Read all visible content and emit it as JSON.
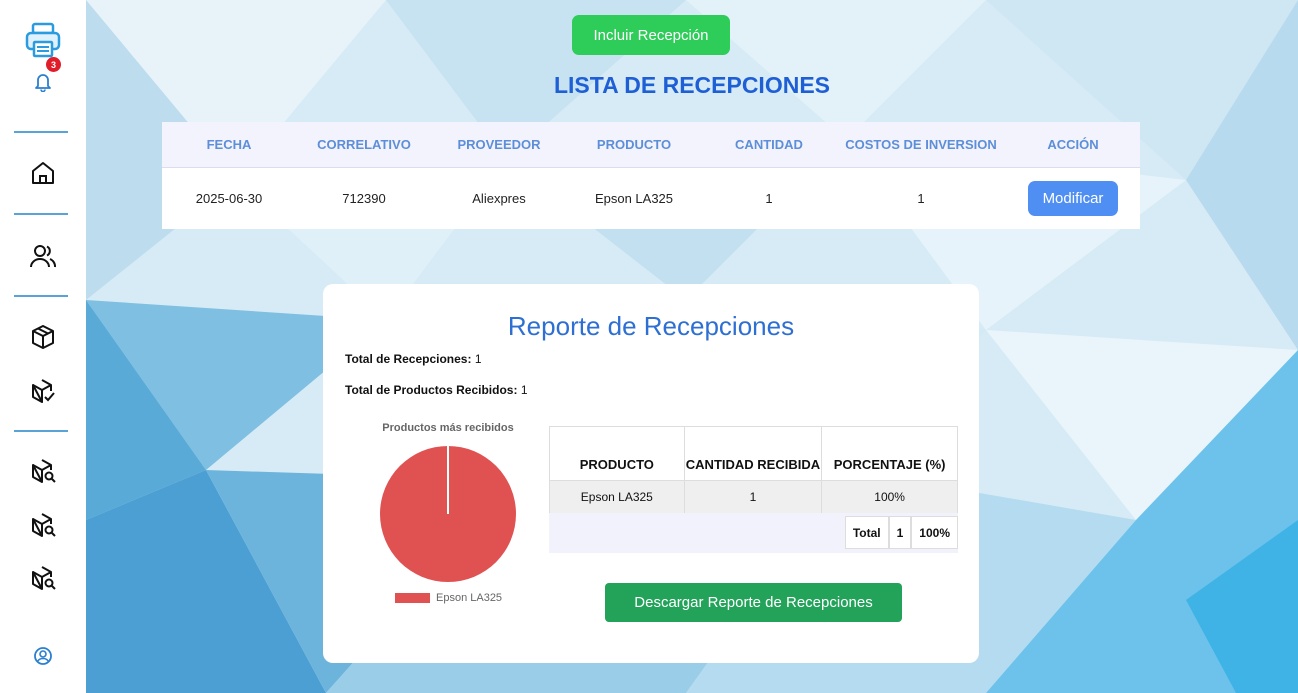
{
  "sidebar": {
    "notification_count": "3",
    "icons": [
      "printer-icon",
      "bell-icon",
      "home-icon",
      "users-icon",
      "box-icon",
      "box-check-icon",
      "box-search-icon",
      "box-search-icon",
      "box-search-icon",
      "user-circle-icon"
    ]
  },
  "header": {
    "include_button": "Incluir Recepción",
    "title": "LISTA DE RECEPCIONES"
  },
  "list_table": {
    "columns": [
      "FECHA",
      "CORRELATIVO",
      "PROVEEDOR",
      "PRODUCTO",
      "CANTIDAD",
      "COSTOS DE INVERSION",
      "ACCIÓN"
    ],
    "rows": [
      {
        "fecha": "2025-06-30",
        "correlativo": "712390",
        "proveedor": "Aliexpres",
        "producto": "Epson LA325",
        "cantidad": "1",
        "costos": "1",
        "accion": "Modificar"
      }
    ]
  },
  "report": {
    "title": "Reporte de Recepciones",
    "total_recepciones_label": "Total de Recepciones:",
    "total_recepciones_value": "1",
    "total_productos_label": "Total de Productos Recibidos:",
    "total_productos_value": "1",
    "chart_title": "Productos más recibidos",
    "table": {
      "columns": [
        "PRODUCTO",
        "CANTIDAD RECIBIDA",
        "PORCENTAJE (%)"
      ],
      "rows": [
        {
          "producto": "Epson LA325",
          "cantidad": "1",
          "porcentaje": "100%"
        }
      ],
      "total_label": "Total",
      "total_cantidad": "1",
      "total_porcentaje": "100%"
    },
    "download_button": "Descargar Reporte de Recepciones"
  },
  "chart_data": {
    "type": "pie",
    "title": "Productos más recibidos",
    "categories": [
      "Epson LA325"
    ],
    "values": [
      1
    ],
    "colors": [
      "#e05252"
    ],
    "legend": "bottom"
  },
  "colors": {
    "accent": "#1f5fd6",
    "include_button": "#2ecc58",
    "modify_button": "#4f8ef2",
    "download_button": "#23a35a"
  }
}
